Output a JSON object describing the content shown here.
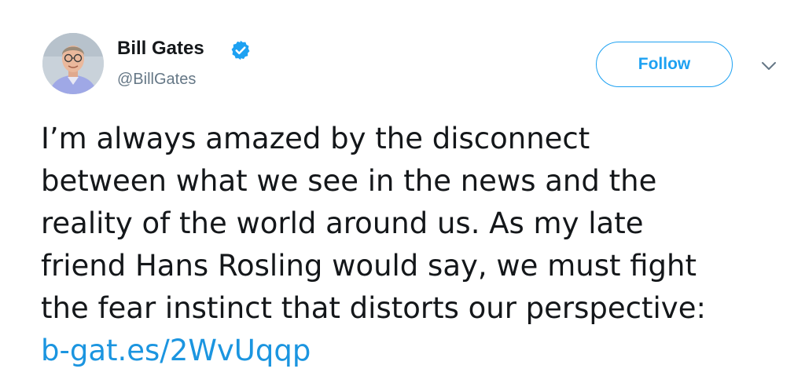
{
  "author": {
    "display_name": "Bill Gates",
    "handle": "@BillGates",
    "verified": true,
    "avatar_icon": "profile-photo"
  },
  "actions": {
    "follow_label": "Follow",
    "menu_icon": "chevron-down-icon"
  },
  "tweet": {
    "lines": [
      "I’m always amazed by the disconnect",
      "between what we see in the news and the",
      "reality of the world around us. As my late",
      "friend Hans Rosling would say, we must fight",
      "the fear instinct that distorts our perspective:"
    ],
    "link": "b-gat.es/2WvUqqp"
  },
  "colors": {
    "accent": "#1da1f2",
    "link": "#1b95e0",
    "text": "#14171a",
    "secondary_text": "#657786",
    "border": "#e1e8ed"
  }
}
